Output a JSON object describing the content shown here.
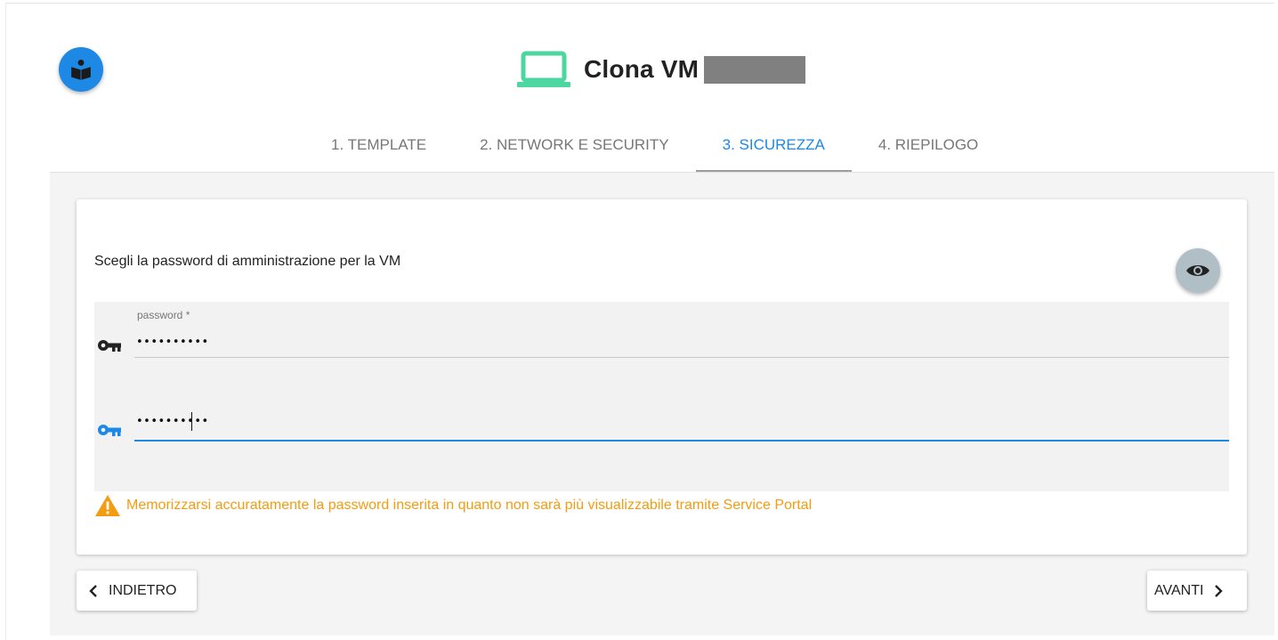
{
  "header": {
    "title": "Clona VM",
    "icon": "laptop-icon",
    "icon_color": "#4cd7a0"
  },
  "help_button": {
    "icon": "book-reader-icon",
    "color": "#1e88e5"
  },
  "tabs": [
    {
      "label": "1. TEMPLATE",
      "active": false
    },
    {
      "label": "2. NETWORK E SECURITY",
      "active": false
    },
    {
      "label": "3. SICUREZZA",
      "active": true
    },
    {
      "label": "4. RIEPILOGO",
      "active": false
    }
  ],
  "security": {
    "instruction": "Scegli la password di amministrazione per la VM",
    "toggle_visibility_icon": "eye-icon",
    "password_field": {
      "label": "password *",
      "value": "••••••••••",
      "icon": "key-icon"
    },
    "confirm_field": {
      "value": "••••••••••",
      "icon": "key-icon",
      "focused": true
    },
    "warning": "Memorizzarsi accuratamente la password inserita in quanto non sarà più visualizzabile tramite Service Portal",
    "warning_icon": "warning-icon"
  },
  "footer": {
    "back_label": "INDIETRO",
    "next_label": "AVANTI"
  },
  "colors": {
    "accent": "#1e88e5",
    "warning": "#f39c12",
    "laptop": "#4cd7a0"
  }
}
